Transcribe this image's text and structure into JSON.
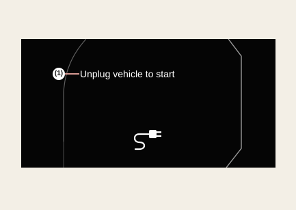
{
  "display": {
    "callout_label": "(1)",
    "message": "Unplug vehicle to start",
    "plug_icon": "charging-plug-icon"
  },
  "colors": {
    "page_background": "#f3efe6",
    "screen_background": "#050505",
    "text": "#ffffff",
    "callout_leader": "#d79a93"
  }
}
